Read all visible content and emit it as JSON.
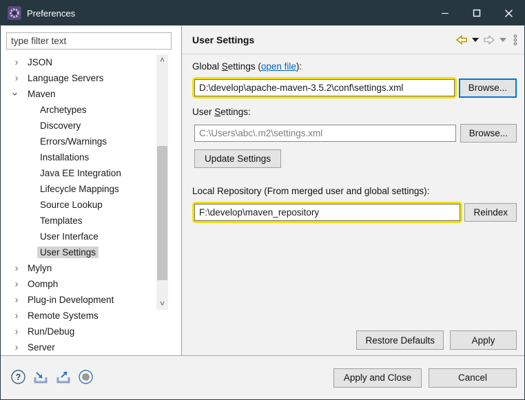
{
  "window": {
    "title": "Preferences",
    "controls": {
      "minimize": "minimize",
      "maximize": "maximize",
      "close": "close"
    }
  },
  "colors": {
    "titlebar": "#26373f",
    "highlight_yellow": "#f5e003",
    "link_blue": "#0066cc",
    "focus_button_blue": "#0078d7",
    "app_icon_purple": "#5b4a82"
  },
  "sidebar": {
    "filter_placeholder": "type filter text",
    "tree": [
      {
        "label": "JSON"
      },
      {
        "label": "Language Servers"
      },
      {
        "label": "Maven"
      },
      {
        "label": "Archetypes"
      },
      {
        "label": "Discovery"
      },
      {
        "label": "Errors/Warnings"
      },
      {
        "label": "Installations"
      },
      {
        "label": "Java EE Integration"
      },
      {
        "label": "Lifecycle Mappings"
      },
      {
        "label": "Source Lookup"
      },
      {
        "label": "Templates"
      },
      {
        "label": "User Interface"
      },
      {
        "label": "User Settings"
      },
      {
        "label": "Mylyn"
      },
      {
        "label": "Oomph"
      },
      {
        "label": "Plug-in Development"
      },
      {
        "label": "Remote Systems"
      },
      {
        "label": "Run/Debug"
      },
      {
        "label": "Server"
      }
    ]
  },
  "main": {
    "page_title": "User Settings",
    "global_settings": {
      "label_pre": "Global ",
      "label_mn": "S",
      "label_post": "ettings (",
      "link": "open file",
      "label_end": "):",
      "value": "D:\\develop\\apache-maven-3.5.2\\conf\\settings.xml",
      "browse_label": "Browse..."
    },
    "user_settings": {
      "label_pre": "User ",
      "label_mn": "S",
      "label_post": "ettings:",
      "value": "C:\\Users\\abc\\.m2\\settings.xml",
      "browse_label": "Browse...",
      "update_label": "Update Settings"
    },
    "local_repository": {
      "label": "Local Repository (From merged user and global settings):",
      "value": "F:\\develop\\maven_repository",
      "reindex_label": "Reindex"
    },
    "footer": {
      "restore_defaults_label": "Restore Defaults",
      "apply_label": "Apply"
    }
  },
  "bottombar": {
    "apply_close_label": "Apply and Close",
    "cancel_label": "Cancel"
  }
}
